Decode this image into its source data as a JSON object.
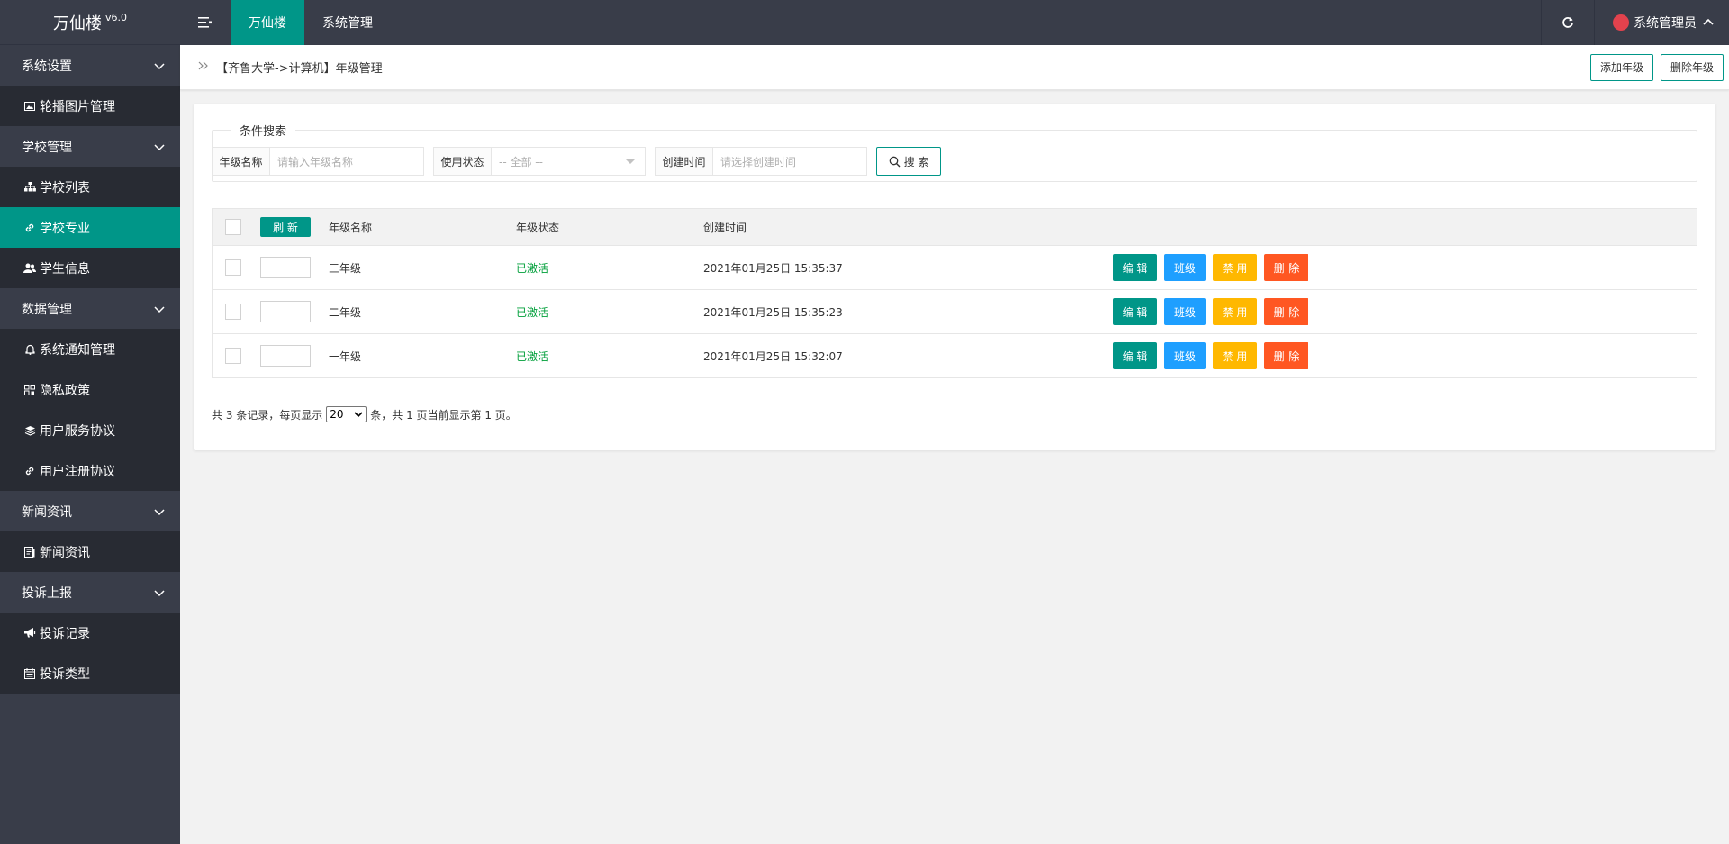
{
  "app": {
    "name": "万仙楼",
    "version": "v6.0"
  },
  "sidebar": {
    "items": [
      {
        "type": "group",
        "label": "系统设置"
      },
      {
        "type": "item",
        "label": "轮播图片管理",
        "icon": "image-icon"
      },
      {
        "type": "group",
        "label": "学校管理"
      },
      {
        "type": "item",
        "label": "学校列表",
        "icon": "sitemap-icon"
      },
      {
        "type": "item",
        "label": "学校专业",
        "icon": "link-icon",
        "active": true
      },
      {
        "type": "item",
        "label": "学生信息",
        "icon": "users-icon"
      },
      {
        "type": "group",
        "label": "数据管理"
      },
      {
        "type": "item",
        "label": "系统通知管理",
        "icon": "bell-icon"
      },
      {
        "type": "item",
        "label": "隐私政策",
        "icon": "grid-icon"
      },
      {
        "type": "item",
        "label": "用户服务协议",
        "icon": "layers-icon"
      },
      {
        "type": "item",
        "label": "用户注册协议",
        "icon": "link-icon"
      },
      {
        "type": "group",
        "label": "新闻资讯"
      },
      {
        "type": "item",
        "label": "新闻资讯",
        "icon": "news-icon"
      },
      {
        "type": "group",
        "label": "投诉上报"
      },
      {
        "type": "item",
        "label": "投诉记录",
        "icon": "bullhorn-icon"
      },
      {
        "type": "item",
        "label": "投诉类型",
        "icon": "calendar-icon"
      }
    ]
  },
  "topbar": {
    "tabs": [
      "万仙楼",
      "系统管理"
    ],
    "user": "系统管理员"
  },
  "breadcrumb": "【齐鲁大学->计算机】年级管理",
  "actions": {
    "add": "添加年级",
    "delete": "删除年级"
  },
  "search": {
    "legend": "条件搜索",
    "name_label": "年级名称",
    "name_placeholder": "请输入年级名称",
    "status_label": "使用状态",
    "status_value": "-- 全部 --",
    "time_label": "创建时间",
    "time_placeholder": "请选择创建时间",
    "button": "搜 索"
  },
  "table": {
    "refresh": "刷 新",
    "headers": [
      "年级名称",
      "年级状态",
      "创建时间"
    ],
    "rows": [
      {
        "name": "三年级",
        "status": "已激活",
        "time": "2021年01月25日 15:35:37"
      },
      {
        "name": "二年级",
        "status": "已激活",
        "time": "2021年01月25日 15:35:23"
      },
      {
        "name": "一年级",
        "status": "已激活",
        "time": "2021年01月25日 15:32:07"
      }
    ],
    "ops": {
      "edit": "编 辑",
      "class": "班级",
      "disable": "禁 用",
      "delete": "删 除"
    }
  },
  "pager": {
    "prefix": "共 3 条记录，每页显示",
    "page_size": "20",
    "suffix": "条，共 1 页当前显示第 1 页。"
  },
  "colors": {
    "sidebar": "#393D49",
    "accent": "#009688",
    "blue": "#1E9FFF",
    "yellow": "#FFB800",
    "red": "#FF5722",
    "active_status": "#009f3a"
  }
}
